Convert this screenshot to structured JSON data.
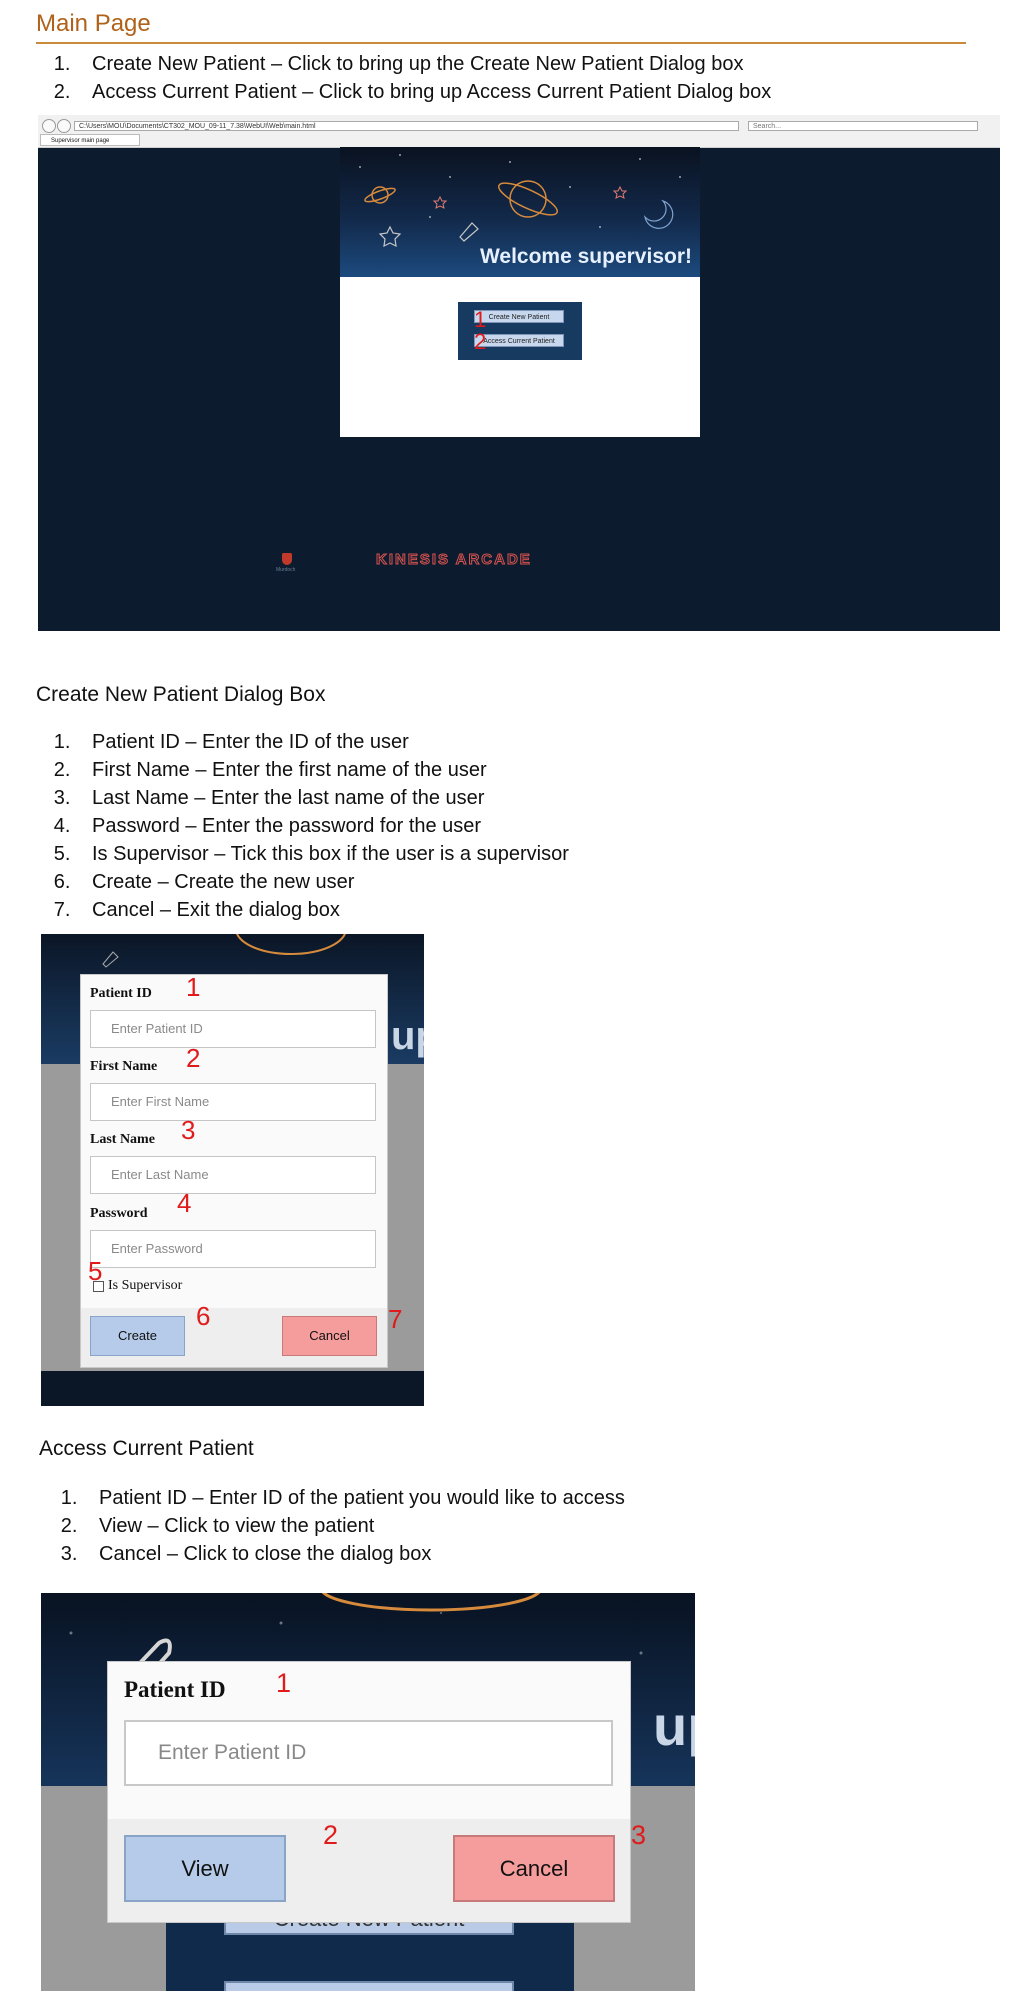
{
  "main_page": {
    "heading": "Main Page",
    "steps": [
      "Create New Patient – Click to bring up the Create New Patient Dialog box",
      "Access Current Patient – Click to bring up Access Current Patient Dialog box"
    ],
    "screenshot": {
      "address": "C:\\Users\\MOU\\Documents\\CT302_MOU_09-11_7.38\\WebUI\\Web\\main.html",
      "search_placeholder": "Search...",
      "tab_title": "Supervisor main page",
      "welcome": "Welcome supervisor!",
      "create_button": "Create New Patient",
      "access_button": "Access Current Patient",
      "markers": [
        "1",
        "2"
      ],
      "arcade_logo": "KINESIS ARCADE",
      "university_logo": "Murdoch"
    }
  },
  "create_section": {
    "title": "Create New Patient Dialog Box",
    "steps": [
      "Patient ID – Enter the ID of the user",
      "First Name – Enter the first name of the user",
      "Last Name – Enter the last name of the user",
      "Password – Enter the password for the user",
      "Is Supervisor – Tick this box if the user is a supervisor",
      "Create – Create the new user",
      "Cancel – Exit the dialog box"
    ],
    "dialog": {
      "patient_id_label": "Patient ID",
      "patient_id_placeholder": "Enter Patient ID",
      "first_name_label": "First Name",
      "first_name_placeholder": "Enter First Name",
      "last_name_label": "Last Name",
      "last_name_placeholder": "Enter Last Name",
      "password_label": "Password",
      "password_placeholder": "Enter Password",
      "supervisor_label": "Is Supervisor",
      "create_button": "Create",
      "cancel_button": "Cancel",
      "background_text": "up",
      "markers": [
        "1",
        "2",
        "3",
        "4",
        "5",
        "6",
        "7"
      ]
    }
  },
  "access_section": {
    "title": "Access Current Patient",
    "steps": [
      "Patient ID – Enter ID of the patient you would like to access",
      "View – Click to view the patient",
      "Cancel – Click to close the dialog box"
    ],
    "dialog": {
      "patient_id_label": "Patient ID",
      "patient_id_placeholder": "Enter Patient ID",
      "view_button": "View",
      "cancel_button": "Cancel",
      "background_button": "Create New Patient",
      "background_text": "up",
      "markers": [
        "1",
        "2",
        "3"
      ]
    }
  },
  "colors": {
    "heading": "#b0621a",
    "marker": "#e01b1b",
    "create_button": "#b5cbe9",
    "cancel_button": "#f59c9c",
    "app_background": "#0c1b2d"
  }
}
